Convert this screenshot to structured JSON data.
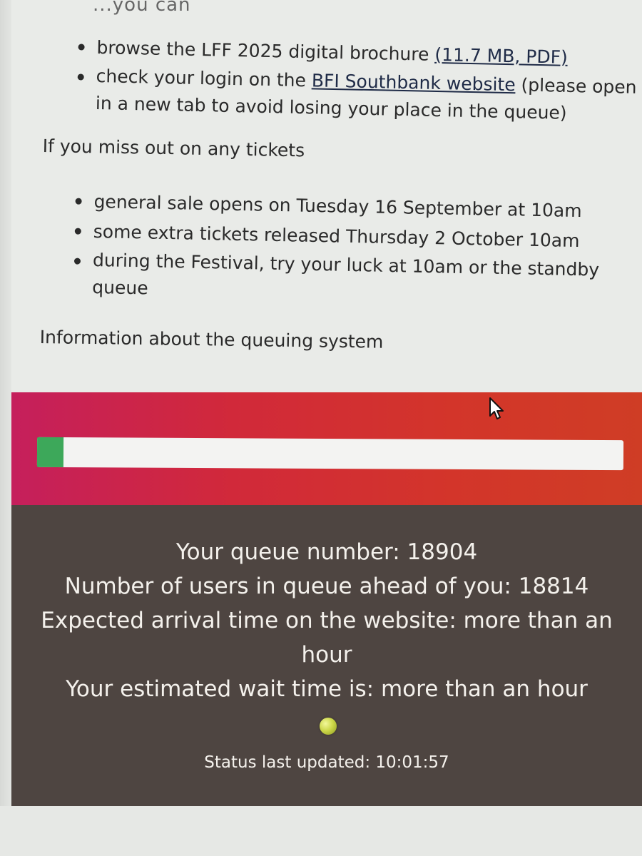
{
  "intro_fragment": "...you can",
  "list_1": [
    {
      "prefix": "browse the LFF 2025 digital brochure ",
      "link": "(11.7 MB, PDF)",
      "suffix": ""
    },
    {
      "prefix": "check your login on the ",
      "link": "BFI Southbank website",
      "suffix": " (please open",
      "line2": "in a new tab to avoid losing your place in the queue)"
    }
  ],
  "miss_heading": "If you miss out on any tickets",
  "list_2": [
    {
      "text": "general sale opens on Tuesday 16 September at 10am"
    },
    {
      "text": "some extra tickets released Thursday 2 October 10am"
    },
    {
      "text": "during the Festival, try your luck at 10am or the standby",
      "line2": "queue"
    }
  ],
  "info_heading": "Information about the queuing system",
  "queue": {
    "progress_fraction": 0.045,
    "progress_color": "#3da85a",
    "header_colors": [
      "#c51f5c",
      "#cf3d25"
    ],
    "lines": [
      "Your queue number: 18904",
      "Number of users in queue ahead of you: 18814",
      "Expected arrival time on the website: more than an",
      "hour",
      "Your estimated wait time is: more than an hour"
    ],
    "status_indicator_color": "#cdd84a",
    "last_updated": "Status last updated: 10:01:57"
  }
}
